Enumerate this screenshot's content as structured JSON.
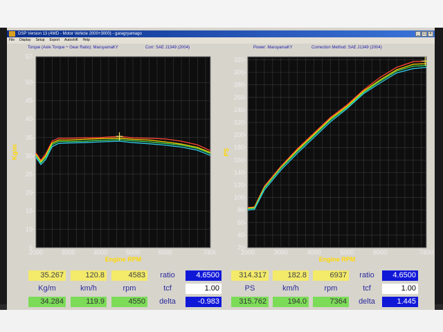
{
  "window": {
    "title": "DSP Version 13 (4WD - Motor Vehicle 2000+3000) - garagryamago",
    "menu": [
      "File",
      "Display",
      "Setup",
      "Export",
      "Autoshift",
      "Help"
    ]
  },
  "left_chart": {
    "header_title": "Torque (Axle Torque ÷ Gear Ratio): MaruyamaKY",
    "header_corr": "Corr: SAE J1349 (2004)"
  },
  "right_chart": {
    "header_title": "Power: MaruyamaKY",
    "header_corr": "Correction Method: SAE J1349 (2004)"
  },
  "chart_data": [
    {
      "type": "line",
      "xlabel": "Engine RPM",
      "ylabel": "Kg/m",
      "xlim": [
        2000,
        7400
      ],
      "ylim": [
        5,
        57
      ],
      "xticks": [
        {
          "value": 2000,
          "label": "2000"
        },
        {
          "value": 3000,
          "label": "3000"
        },
        {
          "value": 4000,
          "label": "4000"
        },
        {
          "value": 5000,
          "label": "5000"
        },
        {
          "value": 6000,
          "label": "6000"
        },
        {
          "value": 7400,
          "label": "7400"
        }
      ],
      "yticks": [
        {
          "value": 5,
          "label": "5-"
        },
        {
          "value": 10,
          "label": "10-"
        },
        {
          "value": 15,
          "label": "15-"
        },
        {
          "value": 20,
          "label": "20-"
        },
        {
          "value": 25,
          "label": "25-"
        },
        {
          "value": 30,
          "label": "30-"
        },
        {
          "value": 35,
          "label": "35-"
        },
        {
          "value": 40,
          "label": "40-"
        },
        {
          "value": 45,
          "label": "45-"
        },
        {
          "value": 50,
          "label": "50-"
        },
        {
          "value": 57,
          "label": "57-"
        }
      ],
      "grid": true,
      "cursor_rpm": 4583,
      "series": [
        {
          "color": "#ff4433",
          "points": [
            [
              2000,
              30.8
            ],
            [
              2150,
              28.8
            ],
            [
              2300,
              30.5
            ],
            [
              2500,
              34.0
            ],
            [
              2700,
              34.8
            ],
            [
              3000,
              34.8
            ],
            [
              3500,
              34.9
            ],
            [
              4000,
              35.0
            ],
            [
              4583,
              35.3
            ],
            [
              5000,
              34.9
            ],
            [
              5500,
              34.8
            ],
            [
              6000,
              34.6
            ],
            [
              6500,
              34.0
            ],
            [
              7000,
              33.0
            ],
            [
              7400,
              31.4
            ]
          ]
        },
        {
          "color": "#ffd700",
          "points": [
            [
              2000,
              30.4
            ],
            [
              2150,
              28.4
            ],
            [
              2300,
              30.0
            ],
            [
              2500,
              33.5
            ],
            [
              2700,
              34.3
            ],
            [
              3000,
              34.3
            ],
            [
              3500,
              34.5
            ],
            [
              4000,
              34.7
            ],
            [
              4583,
              34.8
            ],
            [
              5000,
              34.5
            ],
            [
              5500,
              34.3
            ],
            [
              6000,
              33.8
            ],
            [
              6500,
              33.2
            ],
            [
              7000,
              32.3
            ],
            [
              7400,
              30.9
            ]
          ]
        },
        {
          "color": "#44dd55",
          "points": [
            [
              2000,
              30.1
            ],
            [
              2150,
              28.1
            ],
            [
              2300,
              29.6
            ],
            [
              2500,
              33.1
            ],
            [
              2700,
              33.9
            ],
            [
              3000,
              33.9
            ],
            [
              3500,
              34.0
            ],
            [
              4000,
              34.2
            ],
            [
              4583,
              34.4
            ],
            [
              5000,
              34.1
            ],
            [
              5500,
              33.8
            ],
            [
              6000,
              33.4
            ],
            [
              6500,
              32.9
            ],
            [
              7000,
              32.0
            ],
            [
              7400,
              30.6
            ]
          ]
        },
        {
          "color": "#33ccee",
          "points": [
            [
              2000,
              29.6
            ],
            [
              2150,
              27.6
            ],
            [
              2300,
              29.0
            ],
            [
              2500,
              32.5
            ],
            [
              2700,
              33.4
            ],
            [
              3000,
              33.5
            ],
            [
              3500,
              33.6
            ],
            [
              4000,
              33.8
            ],
            [
              4583,
              34.0
            ],
            [
              5000,
              33.6
            ],
            [
              5500,
              33.3
            ],
            [
              6000,
              32.9
            ],
            [
              6500,
              32.4
            ],
            [
              7000,
              31.5
            ],
            [
              7400,
              30.1
            ]
          ]
        }
      ]
    },
    {
      "type": "line",
      "xlabel": "Engine RPM",
      "ylabel": "PS",
      "xlim": [
        2000,
        7400
      ],
      "ylim": [
        20,
        325
      ],
      "xticks": [
        {
          "value": 2000,
          "label": "2000"
        },
        {
          "value": 3000,
          "label": "3000"
        },
        {
          "value": 4000,
          "label": "4000"
        },
        {
          "value": 5000,
          "label": "5000"
        },
        {
          "value": 6000,
          "label": "6000"
        },
        {
          "value": 7400,
          "label": "7400"
        }
      ],
      "yticks": [
        {
          "value": 20,
          "label": "20-"
        },
        {
          "value": 40,
          "label": "40-"
        },
        {
          "value": 60,
          "label": "60-"
        },
        {
          "value": 80,
          "label": "80-"
        },
        {
          "value": 100,
          "label": "100-"
        },
        {
          "value": 120,
          "label": "120-"
        },
        {
          "value": 140,
          "label": "140-"
        },
        {
          "value": 160,
          "label": "160-"
        },
        {
          "value": 180,
          "label": "180-"
        },
        {
          "value": 200,
          "label": "200-"
        },
        {
          "value": 220,
          "label": "220-"
        },
        {
          "value": 240,
          "label": "240-"
        },
        {
          "value": 260,
          "label": "260-"
        },
        {
          "value": 280,
          "label": "280-"
        },
        {
          "value": 300,
          "label": "300-"
        },
        {
          "value": 320,
          "label": "320-"
        }
      ],
      "grid": true,
      "cursor_rpm": 7364,
      "series": [
        {
          "color": "#ff4433",
          "points": [
            [
              2000,
              84
            ],
            [
              2200,
              85
            ],
            [
              2500,
              118
            ],
            [
              3000,
              150
            ],
            [
              3500,
              178
            ],
            [
              4000,
              203
            ],
            [
              4500,
              228
            ],
            [
              5000,
              248
            ],
            [
              5500,
              272
            ],
            [
              6000,
              292
            ],
            [
              6500,
              308
            ],
            [
              7000,
              317
            ],
            [
              7400,
              318
            ]
          ]
        },
        {
          "color": "#ffd700",
          "points": [
            [
              2000,
              83
            ],
            [
              2200,
              84
            ],
            [
              2500,
              116
            ],
            [
              3000,
              148
            ],
            [
              3500,
              176
            ],
            [
              4000,
              201
            ],
            [
              4500,
              226
            ],
            [
              5000,
              246
            ],
            [
              5500,
              270
            ],
            [
              6000,
              288
            ],
            [
              6500,
              304
            ],
            [
              7000,
              313
            ],
            [
              7400,
              314
            ]
          ]
        },
        {
          "color": "#44dd55",
          "points": [
            [
              2000,
              82
            ],
            [
              2200,
              83
            ],
            [
              2500,
              115
            ],
            [
              3000,
              147
            ],
            [
              3500,
              174
            ],
            [
              4000,
              199
            ],
            [
              4500,
              224
            ],
            [
              5000,
              244
            ],
            [
              5500,
              268
            ],
            [
              6000,
              286
            ],
            [
              6500,
              302
            ],
            [
              7000,
              310
            ],
            [
              7400,
              311
            ]
          ]
        },
        {
          "color": "#33ccee",
          "points": [
            [
              2000,
              80
            ],
            [
              2200,
              81
            ],
            [
              2500,
              112
            ],
            [
              3000,
              144
            ],
            [
              3500,
              171
            ],
            [
              4000,
              196
            ],
            [
              4500,
              221
            ],
            [
              5000,
              242
            ],
            [
              5500,
              266
            ],
            [
              6000,
              283
            ],
            [
              6500,
              299
            ],
            [
              7000,
              306
            ],
            [
              7400,
              308
            ]
          ]
        }
      ]
    }
  ],
  "readouts": {
    "left": {
      "row1": [
        "35.267",
        "120.8",
        "4583"
      ],
      "units": [
        "Kg/m",
        "km/h",
        "rpm"
      ],
      "row3": [
        "34.284",
        "119.9",
        "4550"
      ],
      "ratio_label": "ratio",
      "ratio_value": "4.6500",
      "tcf_label": "tcf",
      "tcf_value": "1.00",
      "delta_label": "delta",
      "delta_value": "-0.983"
    },
    "right": {
      "row1": [
        "314.317",
        "182.8",
        "6937"
      ],
      "units": [
        "PS",
        "km/h",
        "rpm"
      ],
      "row3": [
        "315.762",
        "194.0",
        "7364"
      ],
      "ratio_label": "ratio",
      "ratio_value": "4.6500",
      "tcf_label": "tcf",
      "tcf_value": "1.00",
      "delta_label": "delta",
      "delta_value": "1.445"
    }
  },
  "colors": {
    "chart_bg": "#0e0e0e",
    "grid": "#3a3a3a",
    "header_text": "#1a1aa8",
    "titlebar": "#0b2e8a",
    "cursor": "#f3ea6a"
  }
}
